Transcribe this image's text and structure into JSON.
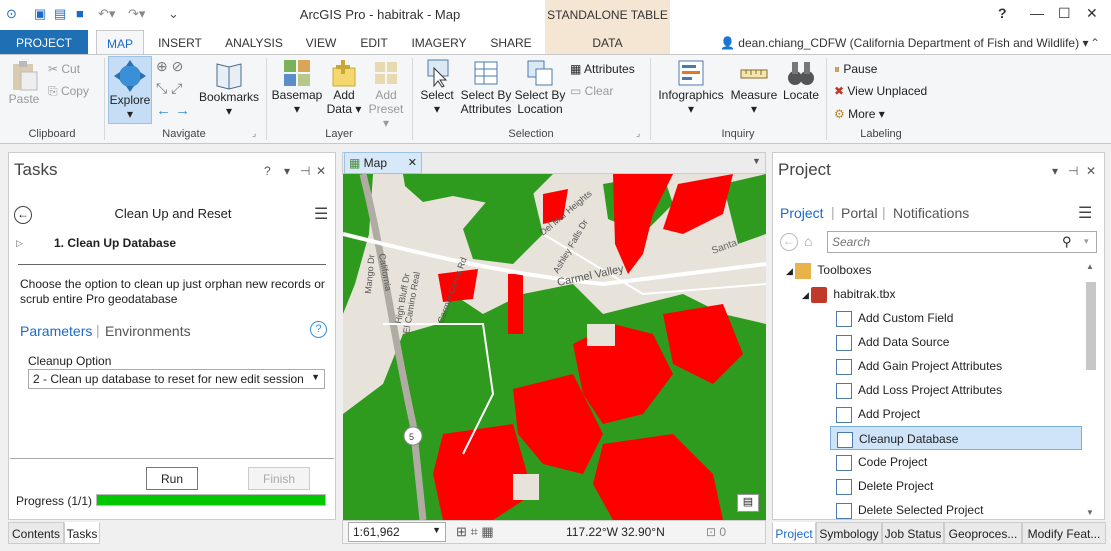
{
  "app": {
    "title": "ArcGIS Pro - habitrak - Map",
    "context_group": "STANDALONE TABLE",
    "help": "?"
  },
  "tabs": [
    "PROJECT",
    "MAP",
    "INSERT",
    "ANALYSIS",
    "VIEW",
    "EDIT",
    "IMAGERY",
    "SHARE",
    "DATA"
  ],
  "user": "dean.chiang_CDFW (California Department of Fish and Wildlife)",
  "ribbon": {
    "clipboard": {
      "label": "Clipboard",
      "paste": "Paste",
      "cut": "Cut",
      "copy": "Copy"
    },
    "navigate": {
      "label": "Navigate",
      "explore": "Explore",
      "bookmarks": "Bookmarks"
    },
    "layer": {
      "label": "Layer",
      "basemap": "Basemap",
      "add_data_1": "Add",
      "add_data_2": "Data",
      "add_preset_1": "Add",
      "add_preset_2": "Preset"
    },
    "selection": {
      "label": "Selection",
      "select": "Select",
      "sba_1": "Select By",
      "sba_2": "Attributes",
      "sbl_1": "Select By",
      "sbl_2": "Location",
      "attributes": "Attributes",
      "clear": "Clear"
    },
    "inquiry": {
      "label": "Inquiry",
      "infographics": "Infographics",
      "measure": "Measure",
      "locate": "Locate"
    },
    "labeling": {
      "label": "Labeling",
      "pause": "Pause",
      "view_unplaced": "View Unplaced",
      "more": "More"
    }
  },
  "tasks": {
    "title": "Tasks",
    "task_name": "Clean Up and Reset",
    "step": "1.  Clean Up Database",
    "description": "Choose the option to clean up just orphan new records or scrub entire Pro geodatabase",
    "tab_parameters": "Parameters",
    "tab_environments": "Environments",
    "option_label": "Cleanup Option",
    "option_value": "2 - Clean up database to reset for new edit session",
    "run": "Run",
    "finish": "Finish",
    "progress": "Progress (1/1)",
    "progress_fraction": 1.0
  },
  "map": {
    "tab": "Map",
    "scale": "1:61,962",
    "coords": "117.22°W 32.90°N",
    "selected_count": "0",
    "labels": {
      "carmel_valley": "Carmel Valley",
      "el_camino": "El Camino Real",
      "high_bluff": "High Bluff Dr",
      "camino_creek": "Carmel Creek Rd",
      "del_mar_heights": "Del Mar Heights",
      "ashley_falls": "Ashley Falls Dr",
      "mango": "Mango Dr",
      "california": "California",
      "santa": "Santa",
      "route": "5"
    }
  },
  "project": {
    "title": "Project",
    "tabs": [
      "Project",
      "Portal",
      "Notifications"
    ],
    "search_placeholder": "Search",
    "toolboxes": "Toolboxes",
    "toolbox": "habitrak.tbx",
    "tools": [
      "Add Custom Field",
      "Add Data Source",
      "Add Gain Project Attributes",
      "Add Loss Project Attributes",
      "Add Project",
      "Cleanup Database",
      "Code Project",
      "Delete Project",
      "Delete Selected Project"
    ],
    "selected_index": 5
  },
  "bottom_tabs_left": [
    "Contents",
    "Tasks"
  ],
  "bottom_tabs_right": [
    "Project",
    "Symbology",
    "Job Status",
    "Geoproces...",
    "Modify Feat..."
  ],
  "colors": {
    "accent": "#1f6fb5",
    "progress": "#00c800",
    "map_green": "#2e9a1e",
    "map_red": "#ff0000"
  }
}
